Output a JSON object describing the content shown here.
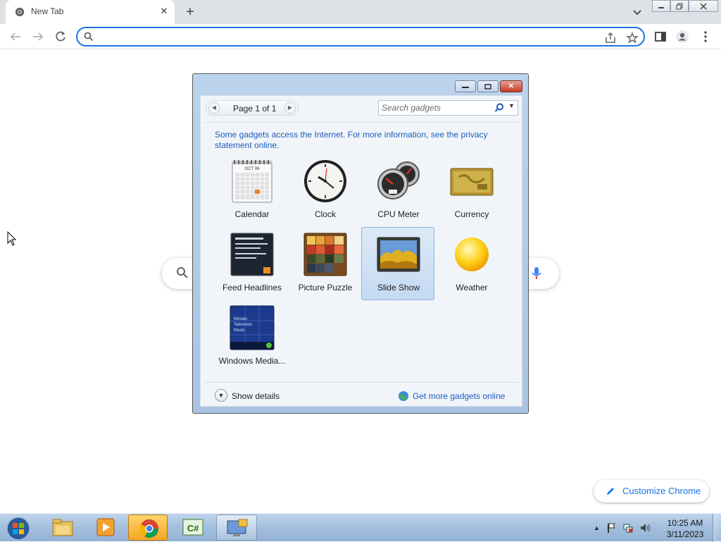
{
  "browser": {
    "tab_title": "New Tab",
    "tab_close": "✕",
    "new_tab": "+",
    "address_value": "",
    "ntp_search_value": "",
    "customize_label": "Customize Chrome"
  },
  "gadgets_window": {
    "window_buttons": {
      "minimize": "▭",
      "maximize": "▢",
      "close": "✕"
    },
    "pager_label": "Page 1 of 1",
    "search_placeholder": "Search gadgets",
    "info_text": "Some gadgets access the Internet.  For more information, see the privacy statement online.",
    "gadgets": [
      {
        "label": "Calendar",
        "icon": "calendar-icon"
      },
      {
        "label": "Clock",
        "icon": "clock-icon"
      },
      {
        "label": "CPU Meter",
        "icon": "cpu-meter-icon"
      },
      {
        "label": "Currency",
        "icon": "currency-icon"
      },
      {
        "label": "Feed Headlines",
        "icon": "feed-headlines-icon"
      },
      {
        "label": "Picture Puzzle",
        "icon": "picture-puzzle-icon"
      },
      {
        "label": "Slide Show",
        "icon": "slide-show-icon",
        "selected": true
      },
      {
        "label": "Weather",
        "icon": "weather-icon"
      },
      {
        "label": "Windows Media...",
        "icon": "windows-media-icon"
      }
    ],
    "calendar_month": "OCT 06",
    "media_lines": [
      "Movies",
      "Television",
      "Music"
    ],
    "show_details": "Show details",
    "get_more": "Get more gadgets online"
  },
  "taskbar": {
    "apps": [
      "windows-explorer-icon",
      "media-player-icon",
      "chrome-icon",
      "csharp-icon",
      "gadgets-icon"
    ],
    "csharp_label": "C#",
    "time": "10:25 AM",
    "date": "3/11/2023"
  },
  "colors": {
    "accent": "#1a73e8",
    "link_blue": "#1e5bb7",
    "window_frame": "#a9c4e2",
    "taskbar": "#a3bfdd"
  }
}
